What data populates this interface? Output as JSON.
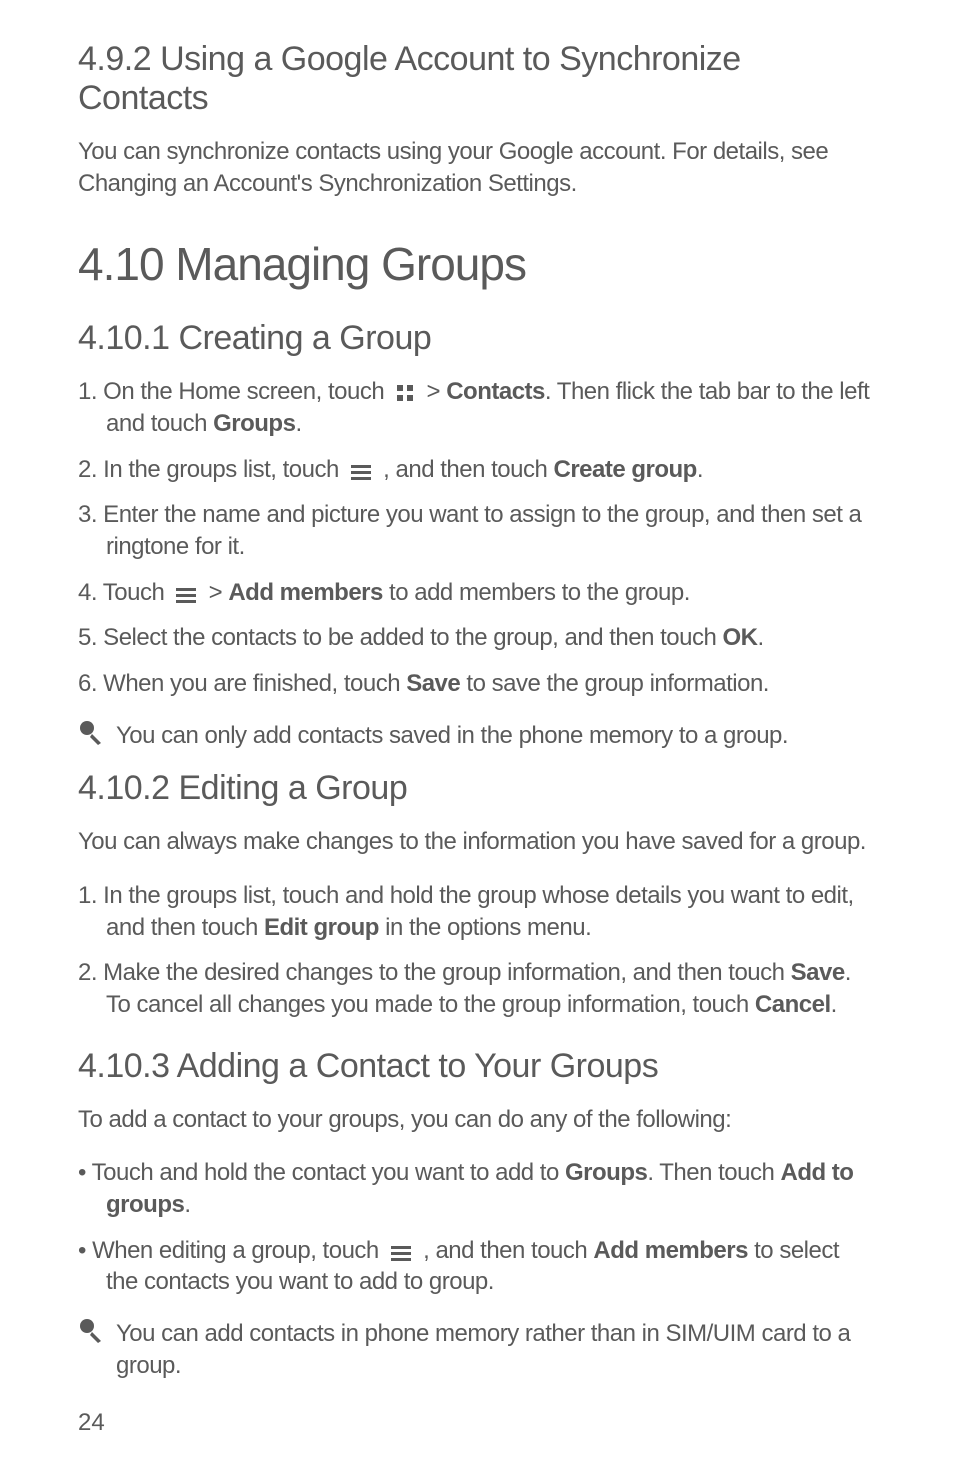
{
  "section_4_9_2": {
    "heading": "4.9.2  Using a Google Account to Synchronize Contacts",
    "body": "You can synchronize contacts using your Google account. For details, see Changing an Account's Synchronization Settings."
  },
  "section_4_10": {
    "heading": "4.10  Managing Groups"
  },
  "section_4_10_1": {
    "heading": "4.10.1  Creating a Group",
    "step1_pre": "1. On the Home screen, touch ",
    "step1_mid": " > ",
    "step1_bold": "Contacts",
    "step1_post": ". Then flick the tab bar to the left and touch ",
    "step1_bold2": "Groups",
    "step1_end": ".",
    "step2_pre": "2. In the groups list, touch ",
    "step2_mid": " , and then touch ",
    "step2_bold": "Create group",
    "step2_end": ".",
    "step3": "3. Enter the name and picture you want to assign to the group, and then set a ringtone for it.",
    "step4_pre": "4. Touch ",
    "step4_mid": " > ",
    "step4_bold": "Add members",
    "step4_post": " to add members to the group.",
    "step5_pre": "5. Select the contacts to be added to the group, and then touch ",
    "step5_bold": "OK",
    "step5_end": ".",
    "step6_pre": "6. When you are finished, touch ",
    "step6_bold": "Save",
    "step6_post": " to save the group information.",
    "note": "You can only add contacts saved in the phone memory to a group."
  },
  "section_4_10_2": {
    "heading": "4.10.2  Editing a Group",
    "body": "You can always make changes to the information you have saved for a group.",
    "step1_pre": "1. In the groups list, touch and hold the group whose details you want to edit, and then touch ",
    "step1_bold": "Edit group",
    "step1_post": " in the options menu.",
    "step2_pre": "2. Make the desired changes to the group information, and then touch ",
    "step2_bold": "Save",
    "step2_mid": ". To cancel all changes you made to the group information, touch ",
    "step2_bold2": "Cancel",
    "step2_end": "."
  },
  "section_4_10_3": {
    "heading": "4.10.3  Adding a Contact to Your Groups",
    "body": "To add a contact to your groups, you can do any of the following:",
    "bullet1_pre": "•  Touch and hold the contact you want to add to ",
    "bullet1_bold1": "Groups",
    "bullet1_mid": ". Then touch ",
    "bullet1_bold2": "Add to groups",
    "bullet1_end": ".",
    "bullet2_pre": "•  When editing a group, touch ",
    "bullet2_mid": " , and then touch ",
    "bullet2_bold": "Add members",
    "bullet2_post": " to select the contacts you want to add to group.",
    "note": "You can add contacts in phone memory rather than in SIM/UIM card to a group."
  },
  "page_number": "24"
}
